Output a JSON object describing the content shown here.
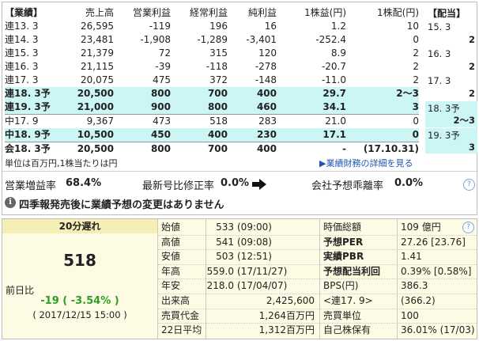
{
  "results": {
    "header": [
      "【業績】",
      "売上高",
      "営業利益",
      "経常利益",
      "純利益",
      "1株益(円)",
      "1株配(円)"
    ],
    "rows": [
      {
        "period": "連13. 3",
        "sales": "26,595",
        "op": "-119",
        "ordinary": "196",
        "net": "16",
        "eps": "1.2",
        "dps": "10",
        "style": "normal"
      },
      {
        "period": "連14. 3",
        "sales": "23,481",
        "op": "-1,908",
        "ordinary": "-1,289",
        "net": "-3,401",
        "eps": "-252.4",
        "dps": "0",
        "style": "normal"
      },
      {
        "period": "連15. 3",
        "sales": "21,379",
        "op": "72",
        "ordinary": "315",
        "net": "120",
        "eps": "8.9",
        "dps": "2",
        "style": "normal"
      },
      {
        "period": "連16. 3",
        "sales": "21,115",
        "op": "-39",
        "ordinary": "-118",
        "net": "-278",
        "eps": "-20.7",
        "dps": "2",
        "style": "normal"
      },
      {
        "period": "連17. 3",
        "sales": "20,075",
        "op": "475",
        "ordinary": "372",
        "net": "-148",
        "eps": "-11.0",
        "dps": "2",
        "style": "normal"
      },
      {
        "period": "連18. 3予",
        "sales": "20,500",
        "op": "800",
        "ordinary": "700",
        "net": "400",
        "eps": "29.7",
        "dps": "2～3",
        "style": "forecast"
      },
      {
        "period": "連19. 3予",
        "sales": "21,000",
        "op": "900",
        "ordinary": "800",
        "net": "460",
        "eps": "34.1",
        "dps": "3",
        "style": "forecast"
      },
      {
        "period": "中17. 9",
        "sales": "9,367",
        "op": "473",
        "ordinary": "518",
        "net": "283",
        "eps": "21.0",
        "dps": "0",
        "style": "half"
      },
      {
        "period": "中18. 9予",
        "sales": "10,500",
        "op": "450",
        "ordinary": "400",
        "net": "230",
        "eps": "17.1",
        "dps": "0",
        "style": "forecast"
      },
      {
        "period": "会18. 3予",
        "sales": "20,500",
        "op": "800",
        "ordinary": "700",
        "net": "400",
        "eps": "-",
        "dps": "(17.10.31)",
        "style": "company"
      }
    ],
    "dividend": {
      "title": "【配当】",
      "items": [
        {
          "year": "15. 3",
          "value": "2",
          "highlight": false
        },
        {
          "year": "16. 3",
          "value": "2",
          "highlight": false
        },
        {
          "year": "17. 3",
          "value": "2",
          "highlight": false
        },
        {
          "year": "18. 3予",
          "value": "2～3",
          "highlight": true
        },
        {
          "year": "19. 3予",
          "value": "3",
          "highlight": true
        }
      ]
    },
    "unit_note": "単位は百万円,1株当たりは円",
    "detail_link": "▶業績財務の詳細を見る",
    "growth": {
      "label": "営業増益率",
      "value": "68.4%"
    },
    "revision": {
      "label": "最新号比修正率",
      "value": "0.0%"
    },
    "deviation": {
      "label": "会社予想乖離率",
      "value": "0.0%"
    },
    "notice": "四季報発売後に業績予想の変更はありません",
    "help": "?"
  },
  "quote": {
    "delay": "20分遅れ",
    "price": "518",
    "change_label": "前日比",
    "change": "-19 ( -3.54% )",
    "timestamp": "( 2017/12/15 15:00 )",
    "colors": {
      "down": "#2f9d29",
      "yellow": "#fdfbe3",
      "yellow_dark": "#f5efb6",
      "link": "#1a55b5"
    },
    "mid": [
      {
        "label": "始値",
        "value": "533",
        "sub": "(09:00)"
      },
      {
        "label": "高値",
        "value": "541",
        "sub": "(09:08)"
      },
      {
        "label": "安値",
        "value": "503",
        "sub": "(12:51)"
      },
      {
        "label": "年高",
        "value": "559.0",
        "sub": "(17/11/27)"
      },
      {
        "label": "年安",
        "value": "218.0",
        "sub": "(17/04/07)"
      },
      {
        "label": "出来高",
        "value": "2,425,600",
        "sub": ""
      },
      {
        "label": "売買代金",
        "value": "1,264百万円",
        "sub": ""
      },
      {
        "label": "22日平均",
        "value": "1,312百万円",
        "sub": ""
      }
    ],
    "right": [
      {
        "label": "時価総額",
        "value": "109 億円",
        "bold": false
      },
      {
        "label": "予想PER",
        "value": "27.26 [23.76]",
        "bold": true
      },
      {
        "label": "実績PBR",
        "value": "1.41",
        "bold": true
      },
      {
        "label": "予想配当利回",
        "value": "0.39% [0.58%]",
        "bold": true
      },
      {
        "label": "BPS(円)",
        "value": "386.3",
        "bold": false
      },
      {
        "label": "<連17. 9>",
        "value": "(366.2)",
        "bold": false
      },
      {
        "label": "売買単位",
        "value": "100",
        "bold": false
      },
      {
        "label": "自己株保有",
        "value": "36.01% (17/03)",
        "bold": false
      }
    ]
  }
}
